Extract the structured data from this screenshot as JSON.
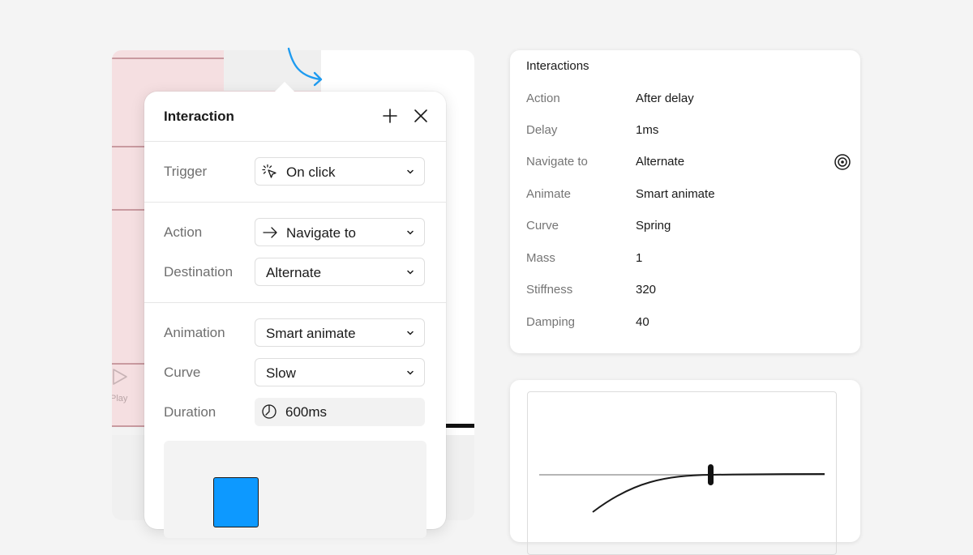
{
  "canvas": {
    "play_label": "Play"
  },
  "interaction_panel": {
    "title": "Interaction",
    "header_icons": [
      "plus-icon",
      "close-icon"
    ],
    "trigger": {
      "label": "Trigger",
      "value": "On click",
      "icon": "tap-cursor-icon"
    },
    "action": {
      "label": "Action",
      "value": "Navigate to",
      "icon": "arrow-right-icon"
    },
    "destination": {
      "label": "Destination",
      "value": "Alternate"
    },
    "animation": {
      "label": "Animation",
      "value": "Smart animate"
    },
    "curve": {
      "label": "Curve",
      "value": "Slow"
    },
    "duration": {
      "label": "Duration",
      "value": "600ms",
      "icon": "timer-icon"
    }
  },
  "interactions_card": {
    "title": "Interactions",
    "rows": [
      {
        "key": "Action",
        "value": "After delay"
      },
      {
        "key": "Delay",
        "value": "1ms"
      },
      {
        "key": "Navigate to",
        "value": "Alternate"
      },
      {
        "key": "Animate",
        "value": "Smart animate"
      },
      {
        "key": "Curve",
        "value": "Spring"
      },
      {
        "key": "Mass",
        "value": "1"
      },
      {
        "key": "Stiffness",
        "value": "320"
      },
      {
        "key": "Damping",
        "value": "40"
      }
    ]
  },
  "colors": {
    "accent_blue": "#0d99ff",
    "frame_pink": "#f5dfe1",
    "frame_line": "#c99aa0",
    "connector_blue": "#1e9bf0"
  }
}
